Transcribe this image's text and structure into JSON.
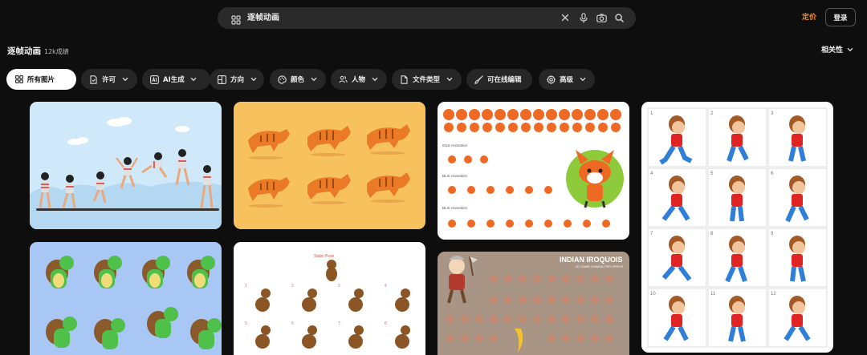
{
  "search": {
    "query": "逐帧动画"
  },
  "header": {
    "pricing_label": "定价",
    "login_label": "登录"
  },
  "results": {
    "title": "逐帧动画",
    "count": "12k成绩",
    "sort_label": "相关性"
  },
  "filters": [
    {
      "label": "所有图片",
      "active": true
    },
    {
      "label": "许可"
    },
    {
      "label": "AI生成"
    },
    {
      "label": "方向"
    },
    {
      "label": "颜色"
    },
    {
      "label": "人物"
    },
    {
      "label": "文件类型"
    },
    {
      "label": "可在线编辑"
    },
    {
      "label": "高级"
    }
  ],
  "gallery": {
    "card3": {
      "label1": "IDLE Animation",
      "label2": "BLIC Animation",
      "label3": "BLIC Animation"
    },
    "card4": {
      "numbers": [
        "1",
        "2",
        "3",
        "4",
        "5",
        "6",
        "7",
        "8",
        "9",
        "10",
        "11",
        "12"
      ]
    },
    "card6": {
      "caption": "Static Pose",
      "numbers": [
        "1",
        "2",
        "3",
        "4",
        "5",
        "6",
        "7",
        "8"
      ]
    },
    "card7": {
      "title": "INDIAN IROQUOIS",
      "subtitle": "2D GAME CHARACTER SPRITE"
    }
  },
  "colors": {
    "accent": "#f08a1c",
    "background": "#0e0e0e",
    "chip": "#262626",
    "search": "#2a2a2a"
  }
}
